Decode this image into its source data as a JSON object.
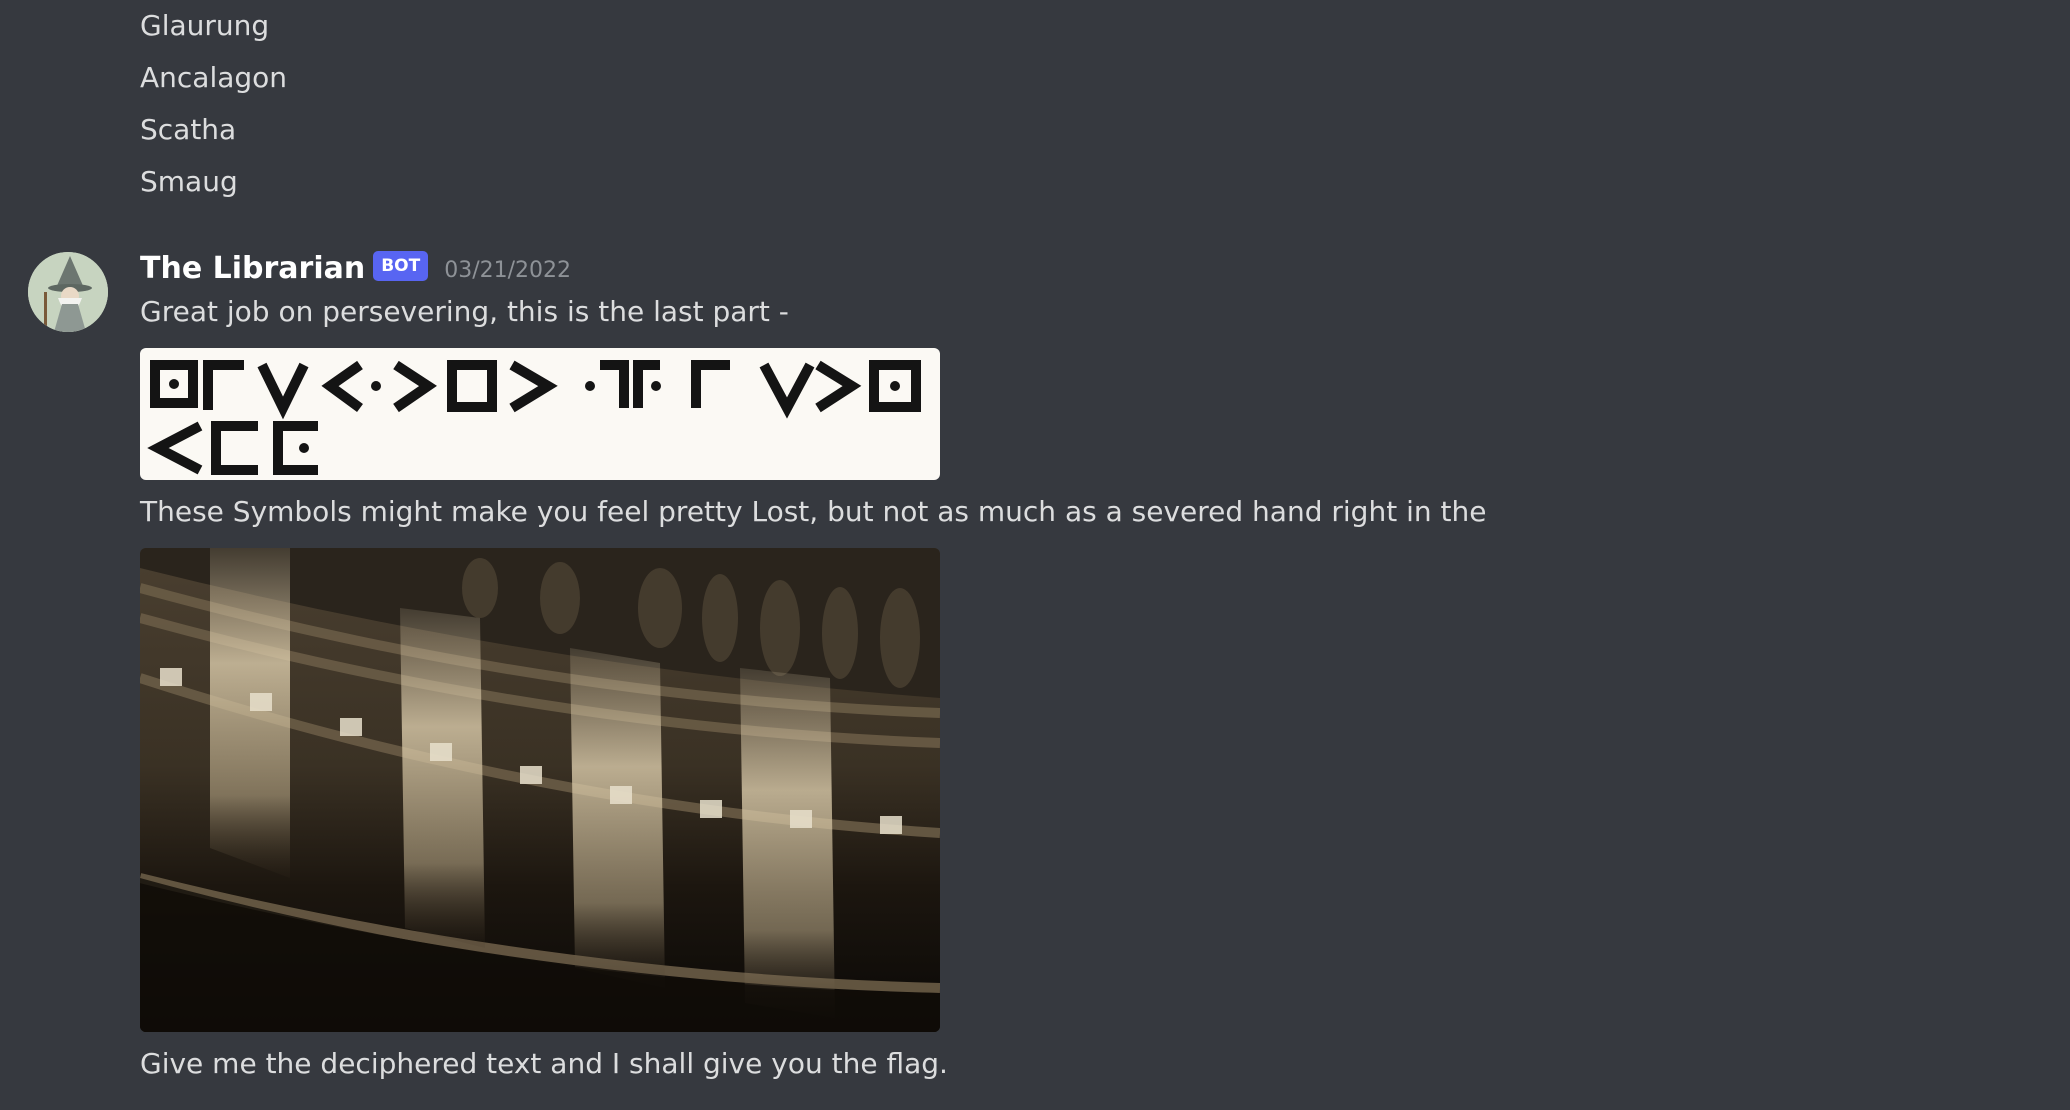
{
  "previous_list": [
    "Glaurung",
    "Ancalagon",
    "Scatha",
    "Smaug"
  ],
  "message": {
    "author": "The Librarian",
    "badge": "BOT",
    "timestamp": "03/21/2022",
    "line1": "Great job on persevering, this is the last part -",
    "line2": "These Symbols might make you feel pretty Lost, but not as much as a severed hand right in the",
    "line3": "Give me the deciphered text and I shall give you the flag."
  },
  "colors": {
    "background": "#36393f",
    "text": "#dcddde",
    "author": "#ffffff",
    "badge": "#5865f2",
    "timestamp": "#8e9297"
  },
  "attachments": {
    "cipher_image_icon": "pigpen-cipher-symbols",
    "photo_image_icon": "rotunda-frieze-photo"
  }
}
